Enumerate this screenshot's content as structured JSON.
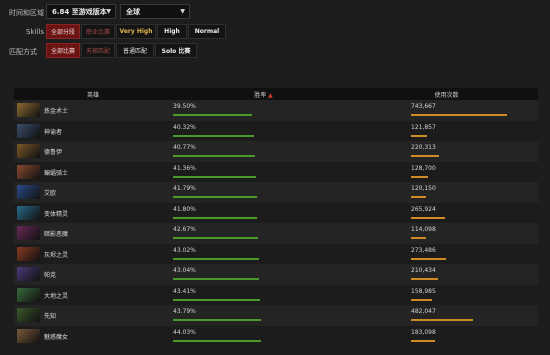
{
  "filters": {
    "time_label": "时间和区域",
    "version_value": "6.84 至游戏版本",
    "region_value": "全球",
    "skills_label": "Skills",
    "skills_options": [
      "全部分段",
      "职业比赛",
      "Very High",
      "High",
      "Normal"
    ],
    "match_label": "匹配方式",
    "match_options": [
      "全部比赛",
      "天梯匹配",
      "普通匹配",
      "Solo 比赛"
    ]
  },
  "table": {
    "col_hero": "英雄",
    "col_winrate": "胜率",
    "col_usage": "使用次数",
    "sort_arrow": "▲",
    "rows": [
      {
        "name": "炼金术士",
        "winrate": "39.50%",
        "win_pct": 39.5,
        "usage": "743,667",
        "usage_n": 743667,
        "color": "#8a6a2e"
      },
      {
        "name": "神谕者",
        "winrate": "40.32%",
        "win_pct": 40.32,
        "usage": "121,857",
        "usage_n": 121857,
        "color": "#3a4e6b"
      },
      {
        "name": "德鲁伊",
        "winrate": "40.77%",
        "win_pct": 40.77,
        "usage": "220,313",
        "usage_n": 220313,
        "color": "#7a5a28"
      },
      {
        "name": "蝙蝠骑士",
        "winrate": "41.36%",
        "win_pct": 41.36,
        "usage": "128,700",
        "usage_n": 128700,
        "color": "#8a4a30"
      },
      {
        "name": "艾欧",
        "winrate": "41.79%",
        "win_pct": 41.79,
        "usage": "120,150",
        "usage_n": 120150,
        "color": "#2a4a8a"
      },
      {
        "name": "变体精灵",
        "winrate": "41.80%",
        "win_pct": 41.8,
        "usage": "265,924",
        "usage_n": 265924,
        "color": "#2a6a8a"
      },
      {
        "name": "暗影恶魔",
        "winrate": "42.67%",
        "win_pct": 42.67,
        "usage": "114,098",
        "usage_n": 114098,
        "color": "#6a2a5a"
      },
      {
        "name": "灰烬之灵",
        "winrate": "43.02%",
        "win_pct": 43.02,
        "usage": "273,486",
        "usage_n": 273486,
        "color": "#8a3a22"
      },
      {
        "name": "帕克",
        "winrate": "43.04%",
        "win_pct": 43.04,
        "usage": "210,434",
        "usage_n": 210434,
        "color": "#4a3a7a"
      },
      {
        "name": "大地之灵",
        "winrate": "43.41%",
        "win_pct": 43.41,
        "usage": "158,985",
        "usage_n": 158985,
        "color": "#3a6a3a"
      },
      {
        "name": "先知",
        "winrate": "43.79%",
        "win_pct": 43.79,
        "usage": "482,047",
        "usage_n": 482047,
        "color": "#3a5a2a"
      },
      {
        "name": "魅惑魔女",
        "winrate": "44.03%",
        "win_pct": 44.03,
        "usage": "183,098",
        "usage_n": 183098,
        "color": "#7a5a3a"
      }
    ]
  }
}
